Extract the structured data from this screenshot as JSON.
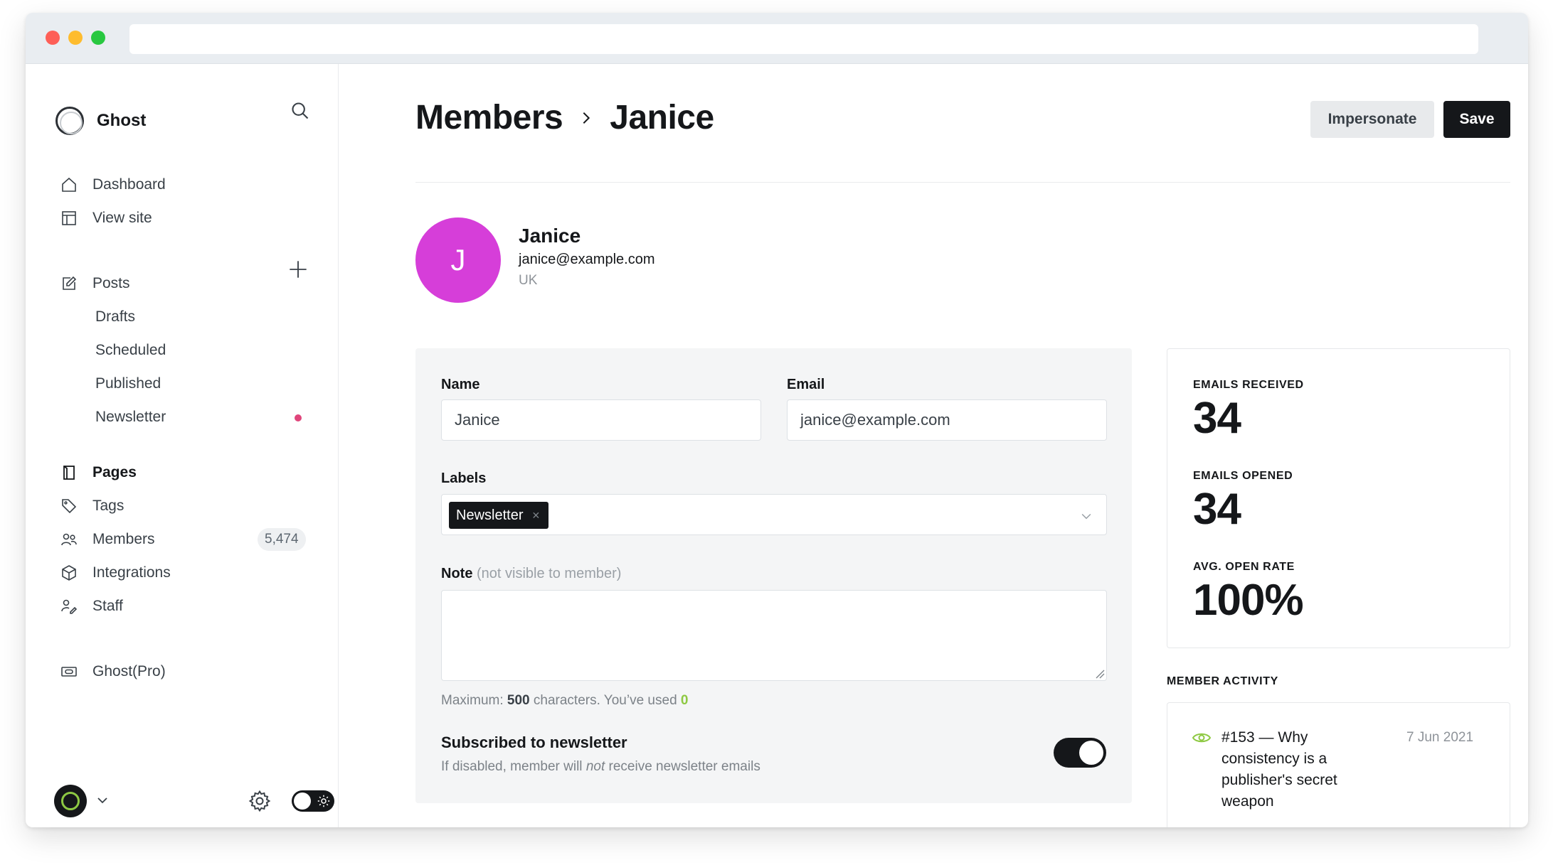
{
  "app": {
    "name": "Ghost"
  },
  "sidebar": {
    "nav": [
      {
        "label": "Dashboard",
        "icon": "home-icon"
      },
      {
        "label": "View site",
        "icon": "layout-icon"
      }
    ],
    "posts": {
      "label": "Posts",
      "subitems": [
        "Drafts",
        "Scheduled",
        "Published",
        "Newsletter"
      ]
    },
    "nav2": [
      {
        "label": "Pages",
        "icon": "page-icon"
      },
      {
        "label": "Tags",
        "icon": "tag-icon"
      },
      {
        "label": "Members",
        "icon": "members-icon",
        "count": "5,474"
      },
      {
        "label": "Integrations",
        "icon": "cube-icon"
      },
      {
        "label": "Staff",
        "icon": "staff-icon"
      }
    ],
    "ghost_pro": {
      "label": "Ghost(Pro)",
      "icon": "card-icon"
    }
  },
  "header": {
    "breadcrumb_parent": "Members",
    "breadcrumb_current": "Janice",
    "impersonate_label": "Impersonate",
    "save_label": "Save"
  },
  "profile": {
    "initial": "J",
    "name": "Janice",
    "email": "janice@example.com",
    "location": "UK",
    "avatar_color": "#d63ed9"
  },
  "form": {
    "name_label": "Name",
    "name_value": "Janice",
    "email_label": "Email",
    "email_value": "janice@example.com",
    "labels_label": "Labels",
    "labels": [
      "Newsletter"
    ],
    "note_label": "Note",
    "note_hint": "(not visible to member)",
    "note_value": "",
    "max_prefix": "Maximum:",
    "max_value": "500",
    "max_suffix": "characters. You’ve used",
    "used_value": "0",
    "subscribed_title": "Subscribed to newsletter",
    "subscribed_desc_1": "If disabled, member will",
    "subscribed_desc_em": "not",
    "subscribed_desc_2": "receive newsletter emails",
    "subscribed": true
  },
  "stats": [
    {
      "label": "EMAILS RECEIVED",
      "value": "34"
    },
    {
      "label": "EMAILS OPENED",
      "value": "34"
    },
    {
      "label": "AVG. OPEN RATE",
      "value": "100%"
    }
  ],
  "activity": {
    "title": "MEMBER ACTIVITY",
    "items": [
      {
        "text": "#153 — Why consistency is a publisher's secret weapon",
        "date": "7 Jun 2021",
        "icon": "eye-icon"
      }
    ]
  },
  "colors": {
    "accent": "#8ec943",
    "dark": "#15171a",
    "pink_dot": "#e0457b"
  }
}
